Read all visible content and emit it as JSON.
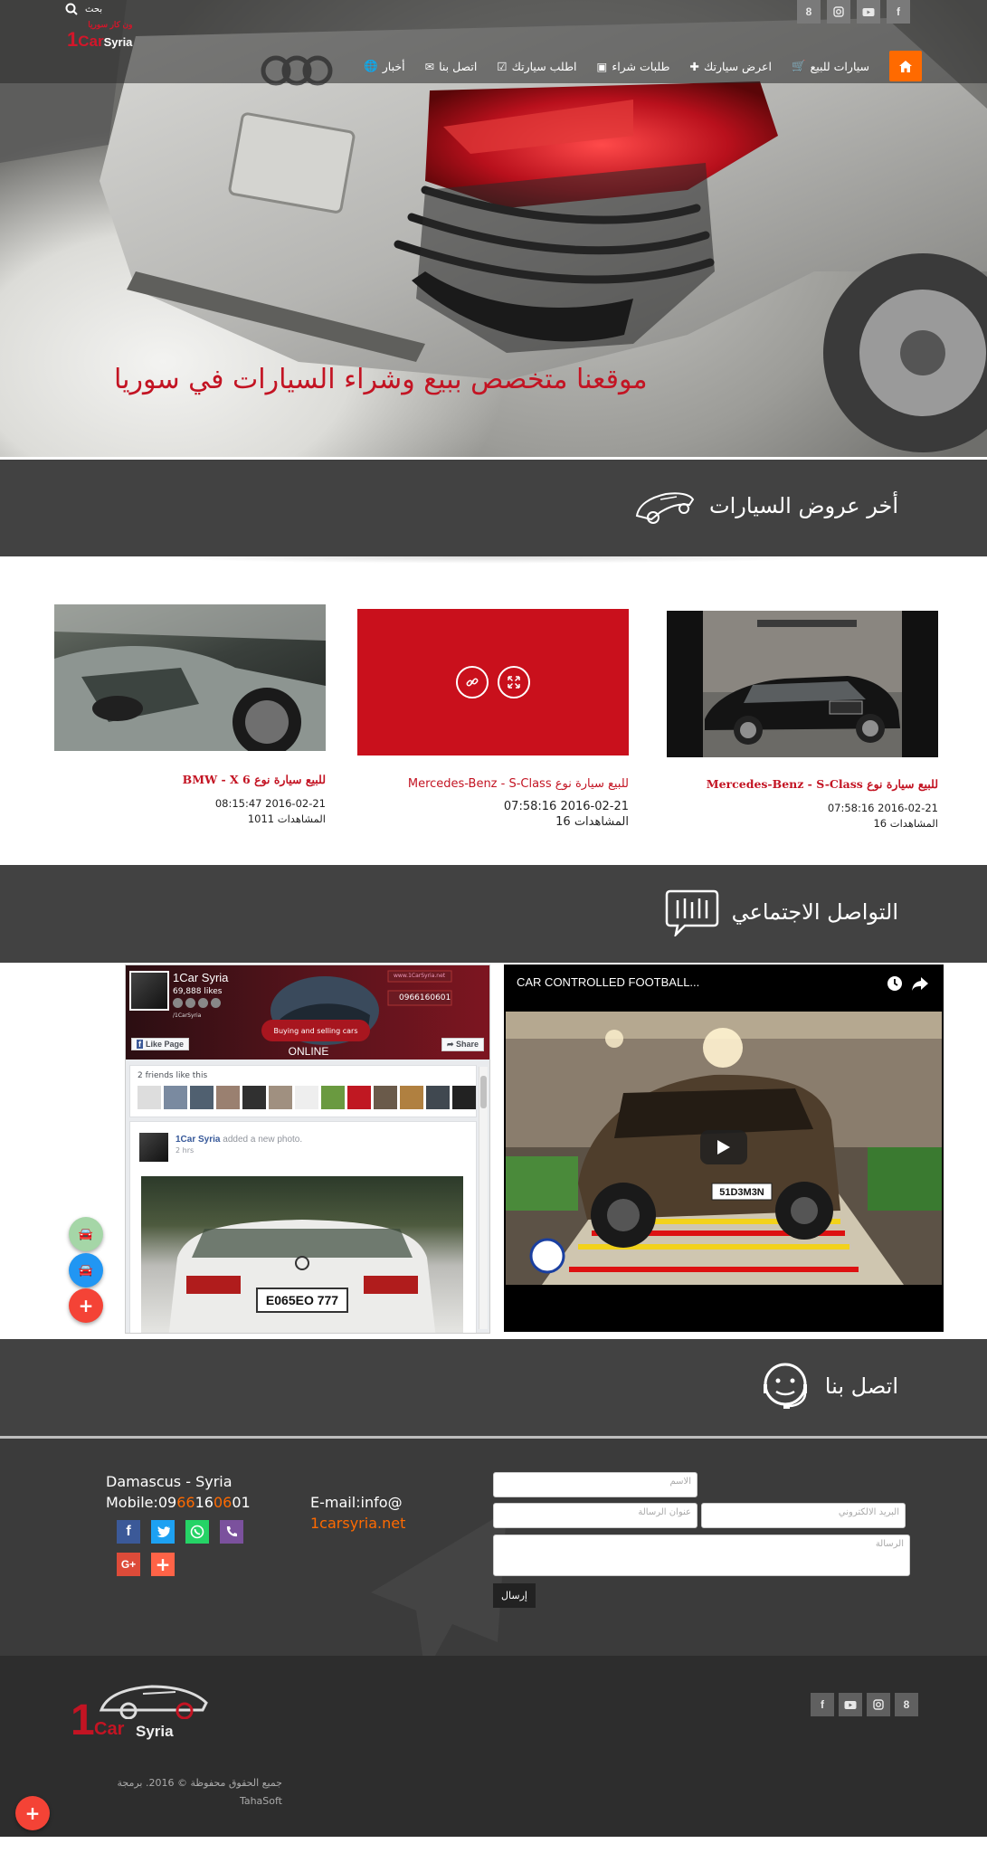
{
  "header": {
    "search_placeholder": "بحث",
    "logo": {
      "one": "1",
      "text_a": "Car",
      "text_b": "Syria",
      "arabic": "ون كار سوريا"
    },
    "social": [
      "8",
      "instagram-icon",
      "youtube-icon",
      "f"
    ],
    "nav": [
      {
        "label": "سيارات للبيع",
        "icon": "cart-icon"
      },
      {
        "label": "اعرض سيارتك",
        "icon": "plus-icon"
      },
      {
        "label": "طلبات شراء",
        "icon": "image-icon"
      },
      {
        "label": "اطلب سيارتك",
        "icon": "check-icon"
      },
      {
        "label": "اتصل بنا",
        "icon": "envelope-icon"
      },
      {
        "label": "أخبار",
        "icon": "globe-icon"
      }
    ],
    "slogan": "موقعنا متخصص ببيع وشراء السيارات في سوريا"
  },
  "offers": {
    "title": "أخر عروض السيارات",
    "cards": [
      {
        "title": "للبيع سيارة نوع BMW - X 6",
        "date": "2016-02-21 08:15:47",
        "views": "المشاهدات 1011"
      },
      {
        "title": "للبيع سيارة نوع Mercedes-Benz - S-Class",
        "date": "2016-02-21 07:58:16",
        "views": "المشاهدات 16"
      },
      {
        "title": "للبيع سيارة نوع Mercedes-Benz - S-Class",
        "date": "2016-02-21 07:58:16",
        "views": "المشاهدات 16"
      }
    ]
  },
  "social_section": {
    "title": "التواصل الاجتماعي",
    "facebook": {
      "page_name": "1Car Syria",
      "likes": "69,888 likes",
      "handle": "/1CarSyria",
      "banner_text": "Buying and selling cars",
      "banner_phone": "0966160601",
      "banner_site": "www.1CarSyria.net",
      "online": "ONLINE",
      "like_button": "Like Page",
      "share_button": "Share",
      "friends_text": "2 friends like this",
      "post_author": "1Car Syria",
      "post_action": "added a new photo.",
      "post_time": "2 hrs",
      "plate": "E065EO 777"
    },
    "youtube": {
      "title": "CAR CONTROLLED FOOTBALL...",
      "plate": "51D3M3N"
    }
  },
  "contact": {
    "title": "اتصل بنا",
    "city": "Damascus - Syria",
    "mobile_label": "Mobile:",
    "mobile_parts": [
      "09",
      "66",
      "16",
      "06",
      "01"
    ],
    "email_label": "E-mail:info@",
    "email_domain": "1carsyria.net",
    "form": {
      "name": "الاسم",
      "subject": "عنوان الرسالة",
      "email": "البريد الالكتروني",
      "message": "الرسالة",
      "submit": "إرسال"
    }
  },
  "footer": {
    "copyright": "جميع الحقوق محفوظة © 2016. برمجة",
    "credit": "TahaSoft",
    "social": [
      "f",
      "youtube-icon",
      "instagram-icon",
      "8"
    ]
  },
  "colors": {
    "accent": "#ff6a00",
    "brand_red": "#c31423",
    "band": "#424242"
  }
}
